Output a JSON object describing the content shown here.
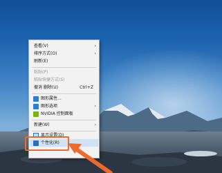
{
  "menu": {
    "view": "查看(V)",
    "sort": "排序方式(O)",
    "refresh": "刷新(E)",
    "paste": "粘贴(P)",
    "paste_shortcut": "粘贴快捷方式(S)",
    "undo_delete": "撤消 删除(U)",
    "undo_shortcut": "Ctrl+Z",
    "graphics_props": "图形属性...",
    "graphics_options": "图形选项",
    "nvidia": "NVIDIA 控制面板",
    "new": "新建(W)",
    "display": "显示设置(D)",
    "personalize": "个性化(R)"
  },
  "colors": {
    "annotation": "#ee6a2c",
    "highlight": "#cfe3f7"
  }
}
